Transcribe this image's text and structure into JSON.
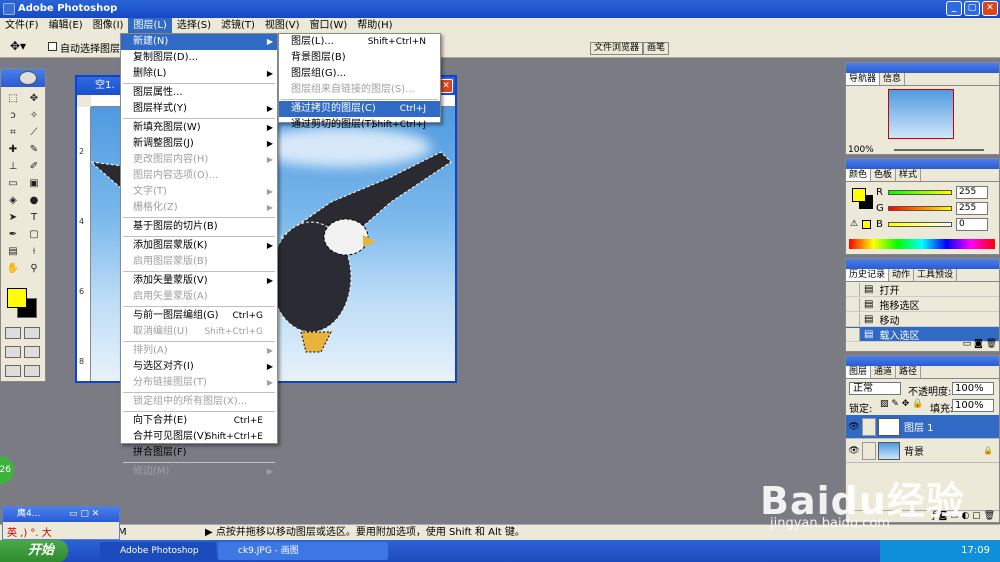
{
  "app": {
    "title": "Adobe Photoshop"
  },
  "menubar": [
    "文件(F)",
    "编辑(E)",
    "图像(I)",
    "图层(L)",
    "选择(S)",
    "滤镜(T)",
    "视图(V)",
    "窗口(W)",
    "帮助(H)"
  ],
  "options": {
    "auto_select_label": "自动选择图层",
    "tabs": [
      "文件浏览器",
      "画笔"
    ]
  },
  "document": {
    "title": "空1.",
    "ruler_marks": [
      "2",
      "4",
      "6",
      "8"
    ]
  },
  "layer_menu": {
    "items": [
      {
        "label": "新建(N)",
        "shortcut": "",
        "submenu": true,
        "disabled": false,
        "highlight": true
      },
      {
        "label": "复制图层(D)...",
        "shortcut": "",
        "submenu": false,
        "disabled": false
      },
      {
        "label": "删除(L)",
        "shortcut": "",
        "submenu": true,
        "disabled": false
      },
      {
        "sep": true
      },
      {
        "label": "图层属性...",
        "shortcut": "",
        "submenu": false,
        "disabled": false
      },
      {
        "label": "图层样式(Y)",
        "shortcut": "",
        "submenu": true,
        "disabled": false
      },
      {
        "sep": true
      },
      {
        "label": "新填充图层(W)",
        "shortcut": "",
        "submenu": true,
        "disabled": false
      },
      {
        "label": "新调整图层(J)",
        "shortcut": "",
        "submenu": true,
        "disabled": false
      },
      {
        "label": "更改图层内容(H)",
        "shortcut": "",
        "submenu": true,
        "disabled": true
      },
      {
        "label": "图层内容选项(O)...",
        "shortcut": "",
        "submenu": false,
        "disabled": true
      },
      {
        "label": "文字(T)",
        "shortcut": "",
        "submenu": true,
        "disabled": true
      },
      {
        "label": "栅格化(Z)",
        "shortcut": "",
        "submenu": true,
        "disabled": true
      },
      {
        "sep": true
      },
      {
        "label": "基于图层的切片(B)",
        "shortcut": "",
        "submenu": false,
        "disabled": false
      },
      {
        "sep": true
      },
      {
        "label": "添加图层蒙版(K)",
        "shortcut": "",
        "submenu": true,
        "disabled": false
      },
      {
        "label": "启用图层蒙版(B)",
        "shortcut": "",
        "submenu": false,
        "disabled": true
      },
      {
        "sep": true
      },
      {
        "label": "添加矢量蒙版(V)",
        "shortcut": "",
        "submenu": true,
        "disabled": false
      },
      {
        "label": "启用矢量蒙版(A)",
        "shortcut": "",
        "submenu": false,
        "disabled": true
      },
      {
        "sep": true
      },
      {
        "label": "与前一图层编组(G)",
        "shortcut": "Ctrl+G",
        "submenu": false,
        "disabled": false
      },
      {
        "label": "取消编组(U)",
        "shortcut": "Shift+Ctrl+G",
        "submenu": false,
        "disabled": true
      },
      {
        "sep": true
      },
      {
        "label": "排列(A)",
        "shortcut": "",
        "submenu": true,
        "disabled": true
      },
      {
        "label": "与选区对齐(I)",
        "shortcut": "",
        "submenu": true,
        "disabled": false
      },
      {
        "label": "分布链接图层(T)",
        "shortcut": "",
        "submenu": true,
        "disabled": true
      },
      {
        "sep": true
      },
      {
        "label": "锁定组中的所有图层(X)...",
        "shortcut": "",
        "submenu": false,
        "disabled": true
      },
      {
        "sep": true
      },
      {
        "label": "向下合并(E)",
        "shortcut": "Ctrl+E",
        "submenu": false,
        "disabled": false
      },
      {
        "label": "合并可见图层(V)",
        "shortcut": "Shift+Ctrl+E",
        "submenu": false,
        "disabled": false
      },
      {
        "label": "拼合图层(F)",
        "shortcut": "",
        "submenu": false,
        "disabled": false
      },
      {
        "sep": true
      },
      {
        "label": "修边(M)",
        "shortcut": "",
        "submenu": true,
        "disabled": true
      }
    ]
  },
  "new_submenu": {
    "items": [
      {
        "label": "图层(L)...",
        "shortcut": "Shift+Ctrl+N",
        "disabled": false
      },
      {
        "label": "背景图层(B)",
        "shortcut": "",
        "disabled": false
      },
      {
        "label": "图层组(G)...",
        "shortcut": "",
        "disabled": false
      },
      {
        "label": "图层组来自链接的图层(S)...",
        "shortcut": "",
        "disabled": true
      },
      {
        "sep": true
      },
      {
        "label": "通过拷贝的图层(C)",
        "shortcut": "Ctrl+J",
        "disabled": false,
        "highlight": true
      },
      {
        "label": "通过剪切的图层(T)",
        "shortcut": "Shift+Ctrl+J",
        "disabled": false
      }
    ]
  },
  "navigator": {
    "tabs": [
      "导航器",
      "信息"
    ],
    "zoom": "100%"
  },
  "color_panel": {
    "tabs": [
      "颜色",
      "色板",
      "样式"
    ],
    "r_label": "R",
    "g_label": "G",
    "b_label": "B",
    "r": "255",
    "g": "255",
    "b": "0"
  },
  "history": {
    "tabs": [
      "历史记录",
      "动作",
      "工具预设"
    ],
    "items": [
      "打开",
      "拖移选区",
      "移动",
      "载入选区"
    ],
    "selected": 3
  },
  "layers": {
    "tabs": [
      "图层",
      "通道",
      "路径"
    ],
    "blend_mode": "正常",
    "opacity_label": "不透明度:",
    "opacity": "100%",
    "lock_label": "锁定:",
    "fill_label": "填充:",
    "fill": "100%",
    "items": [
      {
        "name": "图层 1",
        "selected": true
      },
      {
        "name": "背景",
        "selected": false
      }
    ]
  },
  "statusbar": {
    "text": "▶  点按并拖移以移动图层或选区。要用附加选项，使用 Shift 和 Alt 键。",
    "zoom": "M"
  },
  "ime": {
    "title": "鹰4...",
    "chars": "英 ,) °. 大"
  },
  "taskbar": {
    "start": "开始",
    "tasks": [
      "Adobe Photoshop",
      "ck9.JPG - 画图"
    ],
    "clock": "17:09"
  },
  "badge": {
    "number": "26"
  },
  "watermark": {
    "brand": "Baidu经验",
    "url": "jingyan.baidu.com"
  },
  "colors": {
    "foreground": "#ffff00",
    "background": "#000000",
    "highlight": "#316ac5"
  }
}
